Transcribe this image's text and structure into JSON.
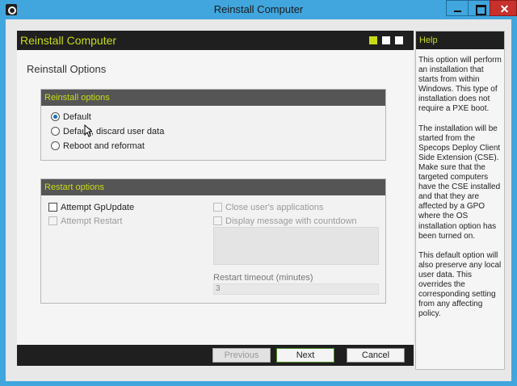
{
  "window": {
    "title": "Reinstall Computer"
  },
  "main": {
    "title": "Reinstall Computer",
    "page_title": "Reinstall Options"
  },
  "reinstall_options": {
    "title": "Reinstall options",
    "options": [
      {
        "label": "Default",
        "selected": true
      },
      {
        "label": "Default, discard user data",
        "selected": false
      },
      {
        "label": "Reboot and reformat",
        "selected": false
      }
    ]
  },
  "restart_options": {
    "title": "Restart options",
    "attempt_gpupdate": "Attempt GpUpdate",
    "attempt_restart": "Attempt Restart",
    "close_apps": "Close user's applications",
    "display_message": "Display message with countdown",
    "timeout_label": "Restart timeout (minutes)",
    "timeout_value": "3"
  },
  "footer": {
    "previous": "Previous",
    "next": "Next",
    "cancel": "Cancel"
  },
  "help": {
    "title": "Help",
    "paragraphs": [
      "This option will perform an installation that starts from within Windows. This type of installation does not require a PXE boot.",
      "The installation will be started from the Specops Deploy Client Side Extension (CSE). Make sure that the targeted computers have the CSE installed and that they are affected by a GPO where the OS installation option has been turned on.",
      "This default option will also preserve any local user data. This overrides the corresponding setting from any affecting policy."
    ]
  },
  "colors": {
    "accent": "#c8dc14",
    "header": "#1f1f1f",
    "window_frame": "#41a6de"
  }
}
